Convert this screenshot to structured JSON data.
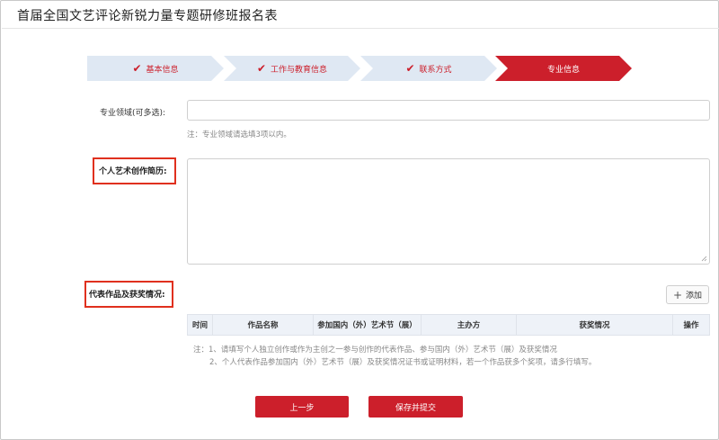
{
  "window": {
    "title": "首届全国文艺评论新锐力量专题研修班报名表"
  },
  "colors": {
    "accent": "#cc1f2b",
    "step_done_bg": "#dfe8f3",
    "highlight_box": "#e0301e"
  },
  "steps": [
    {
      "label": "基本信息",
      "state": "done",
      "icon": "check-icon"
    },
    {
      "label": "工作与教育信息",
      "state": "done",
      "icon": "check-icon"
    },
    {
      "label": "联系方式",
      "state": "done",
      "icon": "check-icon"
    },
    {
      "label": "专业信息",
      "state": "active"
    }
  ],
  "form": {
    "specialty": {
      "label": "专业领域(可多选):",
      "value": "",
      "hint": "注：专业领域请选填3项以内。"
    },
    "resume": {
      "label": "个人艺术创作简历:",
      "value": ""
    },
    "works": {
      "label": "代表作品及获奖情况:",
      "add_label": "添加",
      "columns": [
        "时间",
        "作品名称",
        "参加国内（外）艺术节（展）",
        "主办方",
        "获奖情况",
        "操作"
      ],
      "notes": [
        "注：1、请填写个人独立创作或作为主创之一参与创作的代表作品、参与国内（外）艺术节（展）及获奖情况",
        "2、个人代表作品参加国内（外）艺术节（展）及获奖情况证书或证明材料，若一个作品获多个奖项，请多行填写。"
      ]
    }
  },
  "buttons": {
    "prev": "上一步",
    "submit": "保存并提交"
  }
}
